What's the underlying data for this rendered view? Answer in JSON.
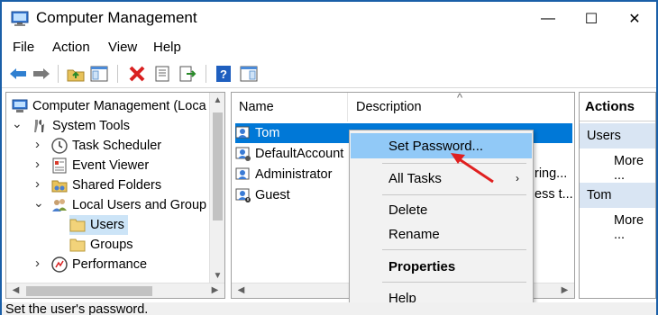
{
  "window": {
    "title": "Computer Management",
    "minimize_glyph": "—",
    "maximize_glyph": "☐",
    "close_glyph": "✕"
  },
  "menu": {
    "items": [
      "File",
      "Action",
      "View",
      "Help"
    ]
  },
  "toolbar": {
    "icons": [
      "back-arrow-icon",
      "forward-arrow-icon",
      "up-folder-icon",
      "show-hide-tree-icon",
      "delete-icon",
      "properties-icon",
      "export-list-icon",
      "help-icon",
      "show-hide-action-pane-icon"
    ]
  },
  "tree": {
    "items": [
      {
        "label": "Computer Management (Loca",
        "level": 0,
        "expander": ""
      },
      {
        "label": "System Tools",
        "level": 1,
        "expander": "⌄"
      },
      {
        "label": "Task Scheduler",
        "level": 2,
        "expander": "›"
      },
      {
        "label": "Event Viewer",
        "level": 2,
        "expander": "›"
      },
      {
        "label": "Shared Folders",
        "level": 2,
        "expander": "›"
      },
      {
        "label": "Local Users and Group",
        "level": 2,
        "expander": "⌄"
      },
      {
        "label": "Users",
        "level": 3,
        "expander": ""
      },
      {
        "label": "Groups",
        "level": 3,
        "expander": ""
      },
      {
        "label": "Performance",
        "level": 2,
        "expander": "›"
      }
    ]
  },
  "list": {
    "columns": [
      "Name",
      "Description"
    ],
    "sort_indicator": "^",
    "rows": [
      {
        "name": "Tom",
        "description": ""
      },
      {
        "name": "DefaultAccount",
        "description": ""
      },
      {
        "name": "Administrator",
        "description": "ring..."
      },
      {
        "name": "Guest",
        "description": "ess t..."
      }
    ]
  },
  "actions": {
    "title": "Actions",
    "sections": [
      {
        "header": "Users",
        "more": "More ..."
      },
      {
        "header": "Tom",
        "more": "More ..."
      }
    ]
  },
  "context_menu": {
    "items": [
      {
        "label": "Set Password...",
        "highlighted": true
      },
      {
        "label": "All Tasks",
        "submenu": true
      },
      {
        "label": "Delete"
      },
      {
        "label": "Rename"
      },
      {
        "label": "Properties",
        "bold": true
      },
      {
        "label": "Help"
      }
    ],
    "submenu_arrow": "›"
  },
  "status": {
    "text": "Set the user's password."
  },
  "colors": {
    "selection": "#0078d7",
    "menu_highlight": "#91c9f7",
    "annotation_arrow": "#e02020"
  }
}
